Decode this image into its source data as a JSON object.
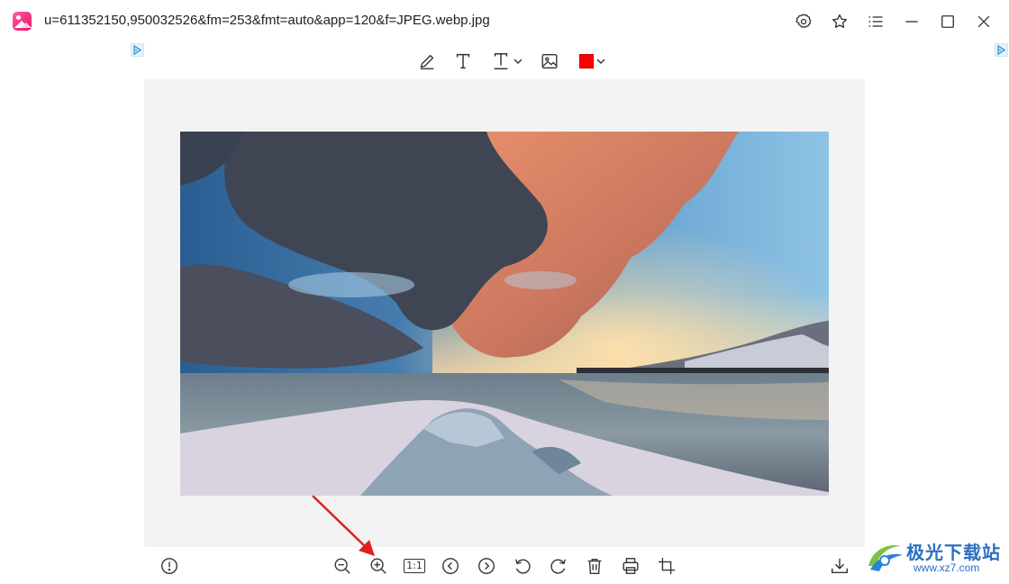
{
  "window": {
    "file_title": "u=611352150,950032526&fm=253&fmt=auto&app=120&f=JPEG.webp.jpg",
    "controls": [
      "gear-icon",
      "star-icon",
      "menu-icon",
      "minimize-icon",
      "maximize-icon",
      "close-icon"
    ]
  },
  "edit_toolbar": {
    "tools": [
      "pen-icon",
      "text-icon",
      "text-style-icon",
      "image-icon",
      "color-picker"
    ],
    "selected_color": "#ff0000"
  },
  "bottom_toolbar": {
    "actual_size_label": "1:1",
    "tools": [
      "info-icon",
      "zoom-out-icon",
      "zoom-in-icon",
      "actual-size",
      "previous-icon",
      "next-icon",
      "rotate-left-icon",
      "rotate-right-icon",
      "delete-icon",
      "print-icon",
      "crop-icon",
      "download-icon"
    ]
  },
  "colors": {
    "canvas_bg": "#f3f3f3",
    "icon": "#333333",
    "annotation_arrow": "#e0201c",
    "app_brand": "#e8106a"
  },
  "watermark": {
    "title": "极光下载站",
    "url": "www.xz7.com"
  }
}
